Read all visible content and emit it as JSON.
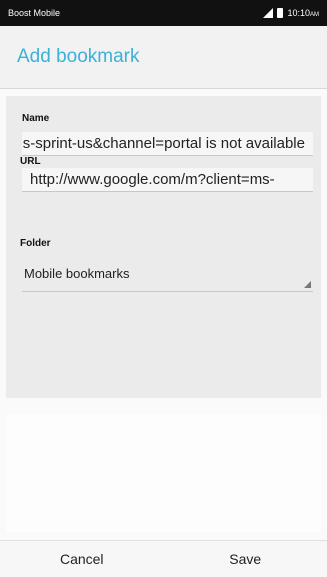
{
  "status_bar": {
    "carrier": "Boost Mobile",
    "time": "10:10",
    "time_suffix": "AM",
    "icons": [
      "signal-icon",
      "battery-icon"
    ]
  },
  "header": {
    "title": "Add bookmark"
  },
  "form": {
    "name_label": "Name",
    "name_value": "‪http://www.google.com/m?client=ms-sprint-us&channel=portal is not available‬",
    "url_label": "URL",
    "url_value": "http://www.google.com/m?client=ms-",
    "folder_label": "Folder",
    "folder_value": "Mobile bookmarks"
  },
  "actions": {
    "cancel_label": "Cancel",
    "save_label": "Save"
  },
  "colors": {
    "accent": "#3bb1d8",
    "statusbar_bg": "#111111"
  }
}
